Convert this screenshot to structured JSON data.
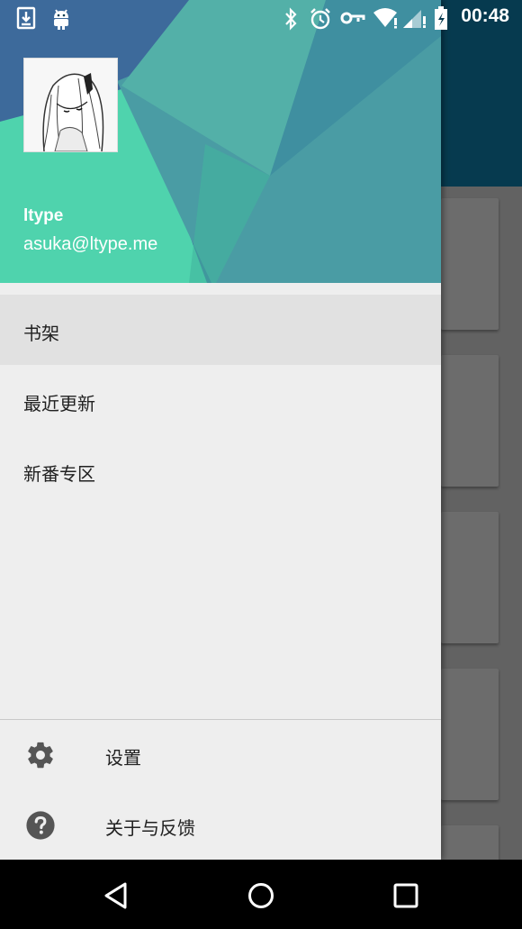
{
  "status_bar": {
    "time": "00:48",
    "icons": [
      "download-icon",
      "android-icon",
      "bluetooth-icon",
      "alarm-icon",
      "vpn-key-icon",
      "wifi-icon",
      "signal-icon",
      "battery-icon"
    ]
  },
  "drawer": {
    "header": {
      "name": "ltype",
      "email": "asuka@ltype.me",
      "colors": {
        "base": "#3d6a9b",
        "teal": "#4aa0a3",
        "mint": "#4fd3ad",
        "light_teal": "#5fb9ae"
      }
    },
    "menu": [
      {
        "label": "书架",
        "selected": true
      },
      {
        "label": "最近更新",
        "selected": false
      },
      {
        "label": "新番专区",
        "selected": false
      }
    ],
    "footer": [
      {
        "label": "设置",
        "icon": "gear-icon"
      },
      {
        "label": "关于与反馈",
        "icon": "help-icon"
      }
    ]
  },
  "nav_bar": {
    "buttons": [
      "back-icon",
      "home-icon",
      "recents-icon"
    ]
  }
}
